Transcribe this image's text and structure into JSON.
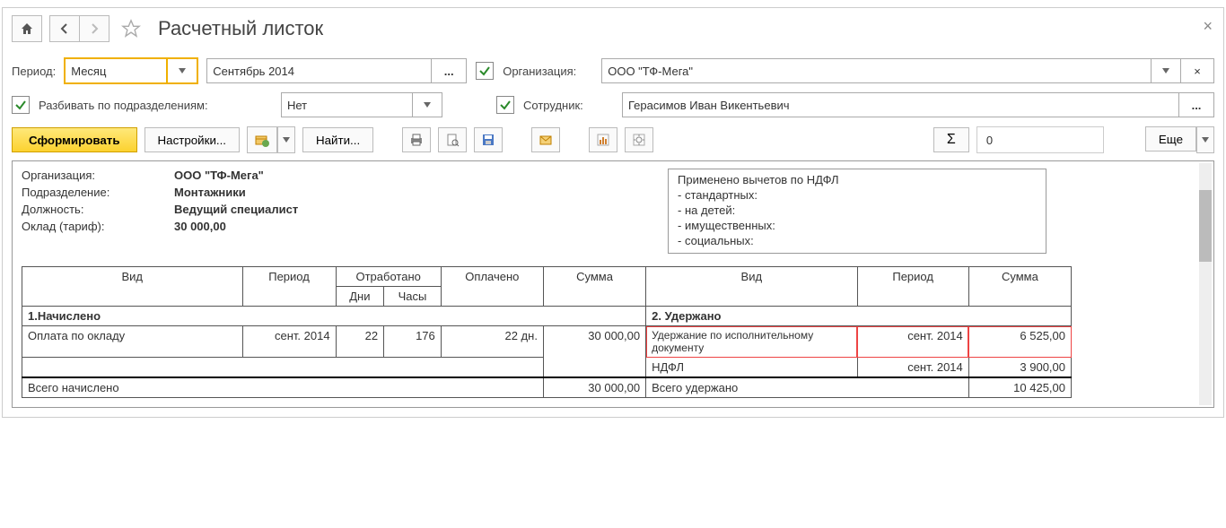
{
  "title": "Расчетный листок",
  "filters": {
    "period_label": "Период:",
    "period_kind": "Месяц",
    "period_value": "Сентябрь 2014",
    "org_label": "Организация:",
    "org_value": "ООО \"ТФ-Мега\"",
    "split_label": "Разбивать по подразделениям:",
    "split_value": "Нет",
    "emp_label": "Сотрудник:",
    "emp_value": "Герасимов Иван Викентьевич"
  },
  "toolbar": {
    "form": "Сформировать",
    "settings": "Настройки...",
    "find": "Найти...",
    "more": "Еще",
    "sum_val": "0"
  },
  "info": {
    "org_k": "Организация:",
    "org_v": "ООО \"ТФ-Мега\"",
    "dept_k": "Подразделение:",
    "dept_v": "Монтажники",
    "pos_k": "Должность:",
    "pos_v": "Ведущий специалист",
    "sal_k": "Оклад (тариф):",
    "sal_v": "30 000,00",
    "ded_title": "Применено вычетов по НДФЛ",
    "ded1": "- стандартных:",
    "ded2": "- на детей:",
    "ded3": "- имущественных:",
    "ded4": "- социальных:"
  },
  "table": {
    "h_type": "Вид",
    "h_period": "Период",
    "h_worked": "Отработано",
    "h_paid": "Оплачено",
    "h_sum": "Сумма",
    "h_days": "Дни",
    "h_hours": "Часы",
    "sec_accrued": "1.Начислено",
    "sec_withheld": "2. Удержано",
    "row1_name": "Оплата по окладу",
    "row1_period": "сент. 2014",
    "row1_days": "22",
    "row1_hours": "176",
    "row1_paid": "22 дн.",
    "row1_sum": "30 000,00",
    "ded1_name": "Удержание по исполнительному документу",
    "ded1_period": "сент. 2014",
    "ded1_sum": "6 525,00",
    "ded2_name": "НДФЛ",
    "ded2_period": "сент. 2014",
    "ded2_sum": "3 900,00",
    "tot_accrued": "Всего начислено",
    "tot_accrued_sum": "30 000,00",
    "tot_withheld": "Всего удержано",
    "tot_withheld_sum": "10 425,00"
  }
}
